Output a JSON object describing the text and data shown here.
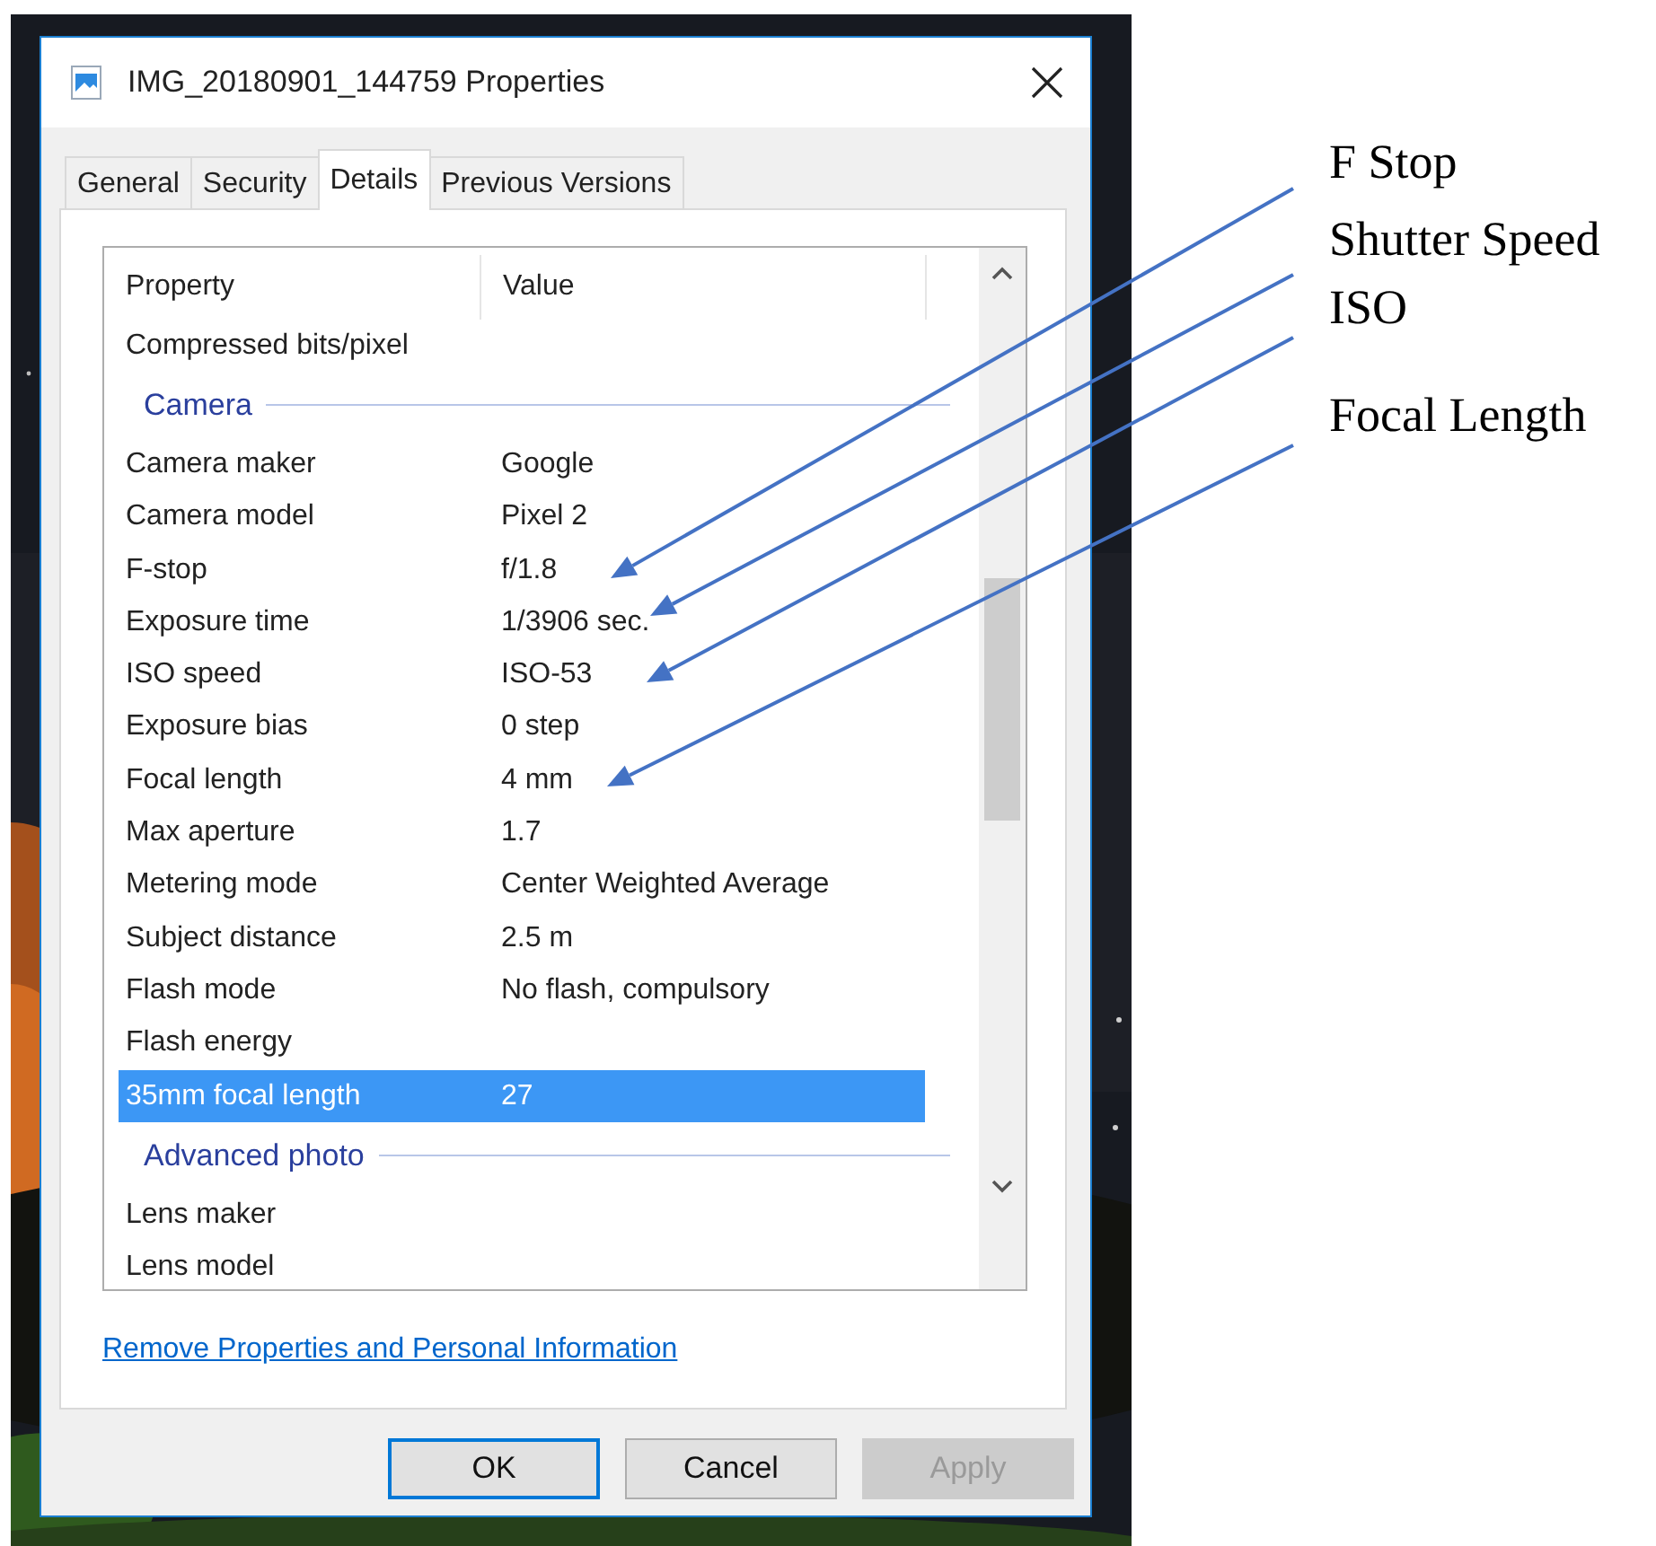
{
  "window": {
    "title": "IMG_20180901_144759 Properties"
  },
  "tabs": [
    {
      "label": "General",
      "selected": false
    },
    {
      "label": "Security",
      "selected": false
    },
    {
      "label": "Details",
      "selected": true
    },
    {
      "label": "Previous Versions",
      "selected": false
    }
  ],
  "columns": [
    "Property",
    "Value"
  ],
  "rows": [
    {
      "kind": "item",
      "property": "Compressed bits/pixel",
      "selected": false
    },
    {
      "kind": "group",
      "label": "Camera"
    },
    {
      "kind": "item",
      "property": "Camera maker",
      "value": "Google",
      "selected": false
    },
    {
      "kind": "item",
      "property": "Camera model",
      "value": "Pixel 2",
      "selected": false
    },
    {
      "kind": "item",
      "property": "F-stop",
      "value": "f/1.8",
      "selected": false
    },
    {
      "kind": "item",
      "property": "Exposure time",
      "value": "1/3906 sec.",
      "selected": false
    },
    {
      "kind": "item",
      "property": "ISO speed",
      "value": "ISO-53",
      "selected": false
    },
    {
      "kind": "item",
      "property": "Exposure bias",
      "value": "0 step",
      "selected": false
    },
    {
      "kind": "item",
      "property": "Focal length",
      "value": "4 mm",
      "selected": false
    },
    {
      "kind": "item",
      "property": "Max aperture",
      "value": "1.7",
      "selected": false
    },
    {
      "kind": "item",
      "property": "Metering mode",
      "value": "Center Weighted Average",
      "selected": false
    },
    {
      "kind": "item",
      "property": "Subject distance",
      "value": "2.5 m",
      "selected": false
    },
    {
      "kind": "item",
      "property": "Flash mode",
      "value": "No flash, compulsory",
      "selected": false
    },
    {
      "kind": "item",
      "property": "Flash energy",
      "selected": false
    },
    {
      "kind": "item",
      "property": "35mm focal length",
      "value": "27",
      "selected": true
    },
    {
      "kind": "group",
      "label": "Advanced photo"
    },
    {
      "kind": "item",
      "property": "Lens maker",
      "selected": false
    },
    {
      "kind": "item",
      "property": "Lens model",
      "selected": false
    }
  ],
  "link": "Remove Properties and Personal Information",
  "buttons": [
    {
      "label": "OK",
      "default": true,
      "disabled": false
    },
    {
      "label": "Cancel",
      "default": false,
      "disabled": false
    },
    {
      "label": "Apply",
      "default": false,
      "disabled": true
    }
  ],
  "annotations": [
    {
      "label": "F Stop"
    },
    {
      "label": "Shutter Speed"
    },
    {
      "label": "ISO"
    },
    {
      "label": "Focal Length"
    }
  ]
}
